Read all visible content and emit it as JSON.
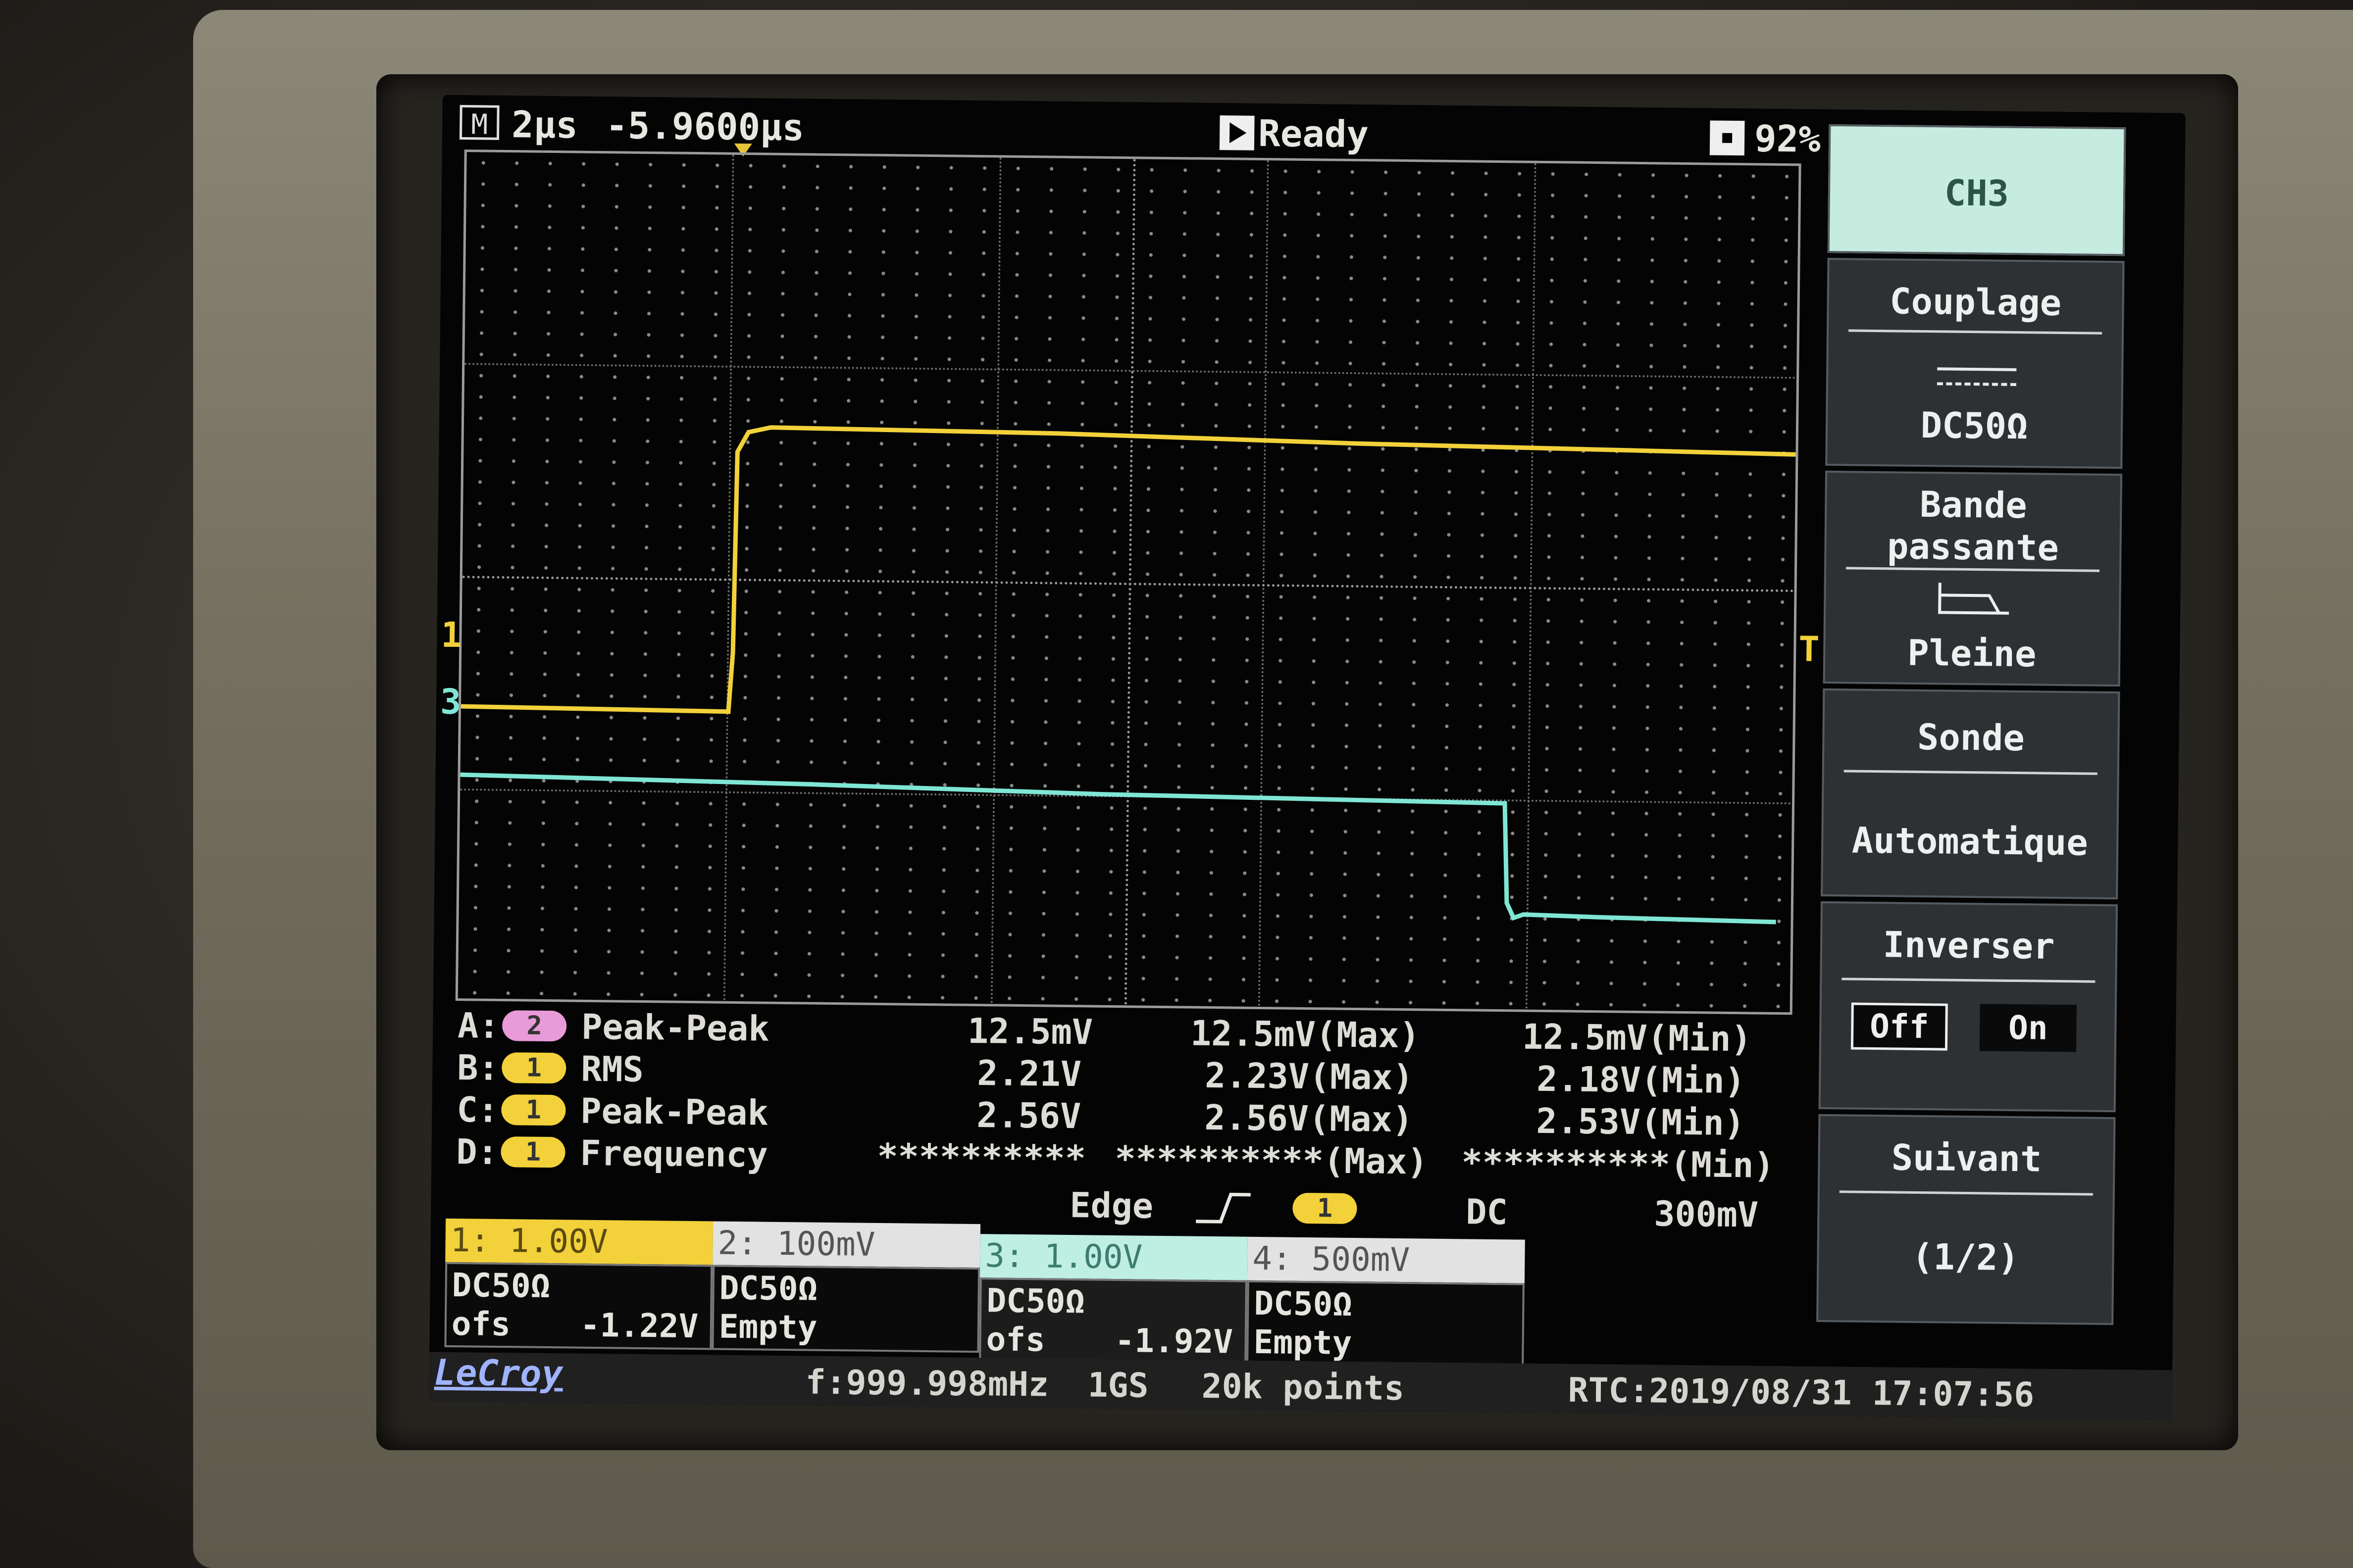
{
  "top_bar": {
    "mode_label": "M",
    "timebase": "2µs",
    "delay": "-5.9600µs",
    "acquisition_status": "Ready",
    "battery_level": "92%"
  },
  "channel_markers": {
    "ch1": "1",
    "ch3": "3",
    "trigger": "T"
  },
  "waveforms": {
    "ch1": {
      "color": "#f2d13a",
      "shape": "rising-step"
    },
    "ch3": {
      "color": "#7fe6d4",
      "shape": "falling-step"
    }
  },
  "menu": {
    "title": "CH3",
    "coupling": {
      "label": "Couplage",
      "value": "DC50Ω"
    },
    "bandwidth": {
      "label_line1": "Bande",
      "label_line2": "passante",
      "value": "Pleine"
    },
    "probe": {
      "label": "Sonde",
      "value": "Automatique"
    },
    "invert": {
      "label": "Inverser",
      "off": "Off",
      "on": "On"
    },
    "next": {
      "label": "Suivant",
      "page": "(1/2)"
    }
  },
  "measurements": [
    {
      "slot": "A:",
      "channel": "2",
      "name": "Peak-Peak",
      "value": "12.5mV",
      "max": "12.5mV(Max)",
      "min": "12.5mV(Min)"
    },
    {
      "slot": "B:",
      "channel": "1",
      "name": "RMS",
      "value": "2.21V",
      "max": "2.23V(Max)",
      "min": "2.18V(Min)"
    },
    {
      "slot": "C:",
      "channel": "1",
      "name": "Peak-Peak",
      "value": "2.56V",
      "max": "2.56V(Max)",
      "min": "2.53V(Min)"
    },
    {
      "slot": "D:",
      "channel": "1",
      "name": "Frequency",
      "value": "**********",
      "max": "**********(Max)",
      "min": "**********(Min)"
    }
  ],
  "trigger": {
    "type": "Edge",
    "source": "1",
    "coupling": "DC",
    "level": "300mV"
  },
  "channels": [
    {
      "header": "1: 1.00V",
      "coupling": "DC50Ω",
      "line2_label": "ofs",
      "offset": "-1.22V"
    },
    {
      "header": "2: 100mV",
      "coupling": "DC50Ω",
      "line2_label": "Empty",
      "offset": ""
    },
    {
      "header": "3: 1.00V",
      "coupling": "DC50Ω",
      "line2_label": "ofs",
      "offset": "-1.92V"
    },
    {
      "header": "4: 500mV",
      "coupling": "DC50Ω",
      "line2_label": "Empty",
      "offset": ""
    }
  ],
  "status_bar": {
    "brand": "LeCroy",
    "frequency": "f:999.998mHz",
    "sample_rate": "1GS",
    "record_length": "20k points",
    "rtc": "RTC:2019/08/31 17:07:56"
  },
  "colors": {
    "ch1": "#f2d13a",
    "ch2": "#e99ad8",
    "ch3": "#7fe6d4",
    "ch4": "#d9d9d9",
    "menu_active": "#c5ecdf"
  }
}
